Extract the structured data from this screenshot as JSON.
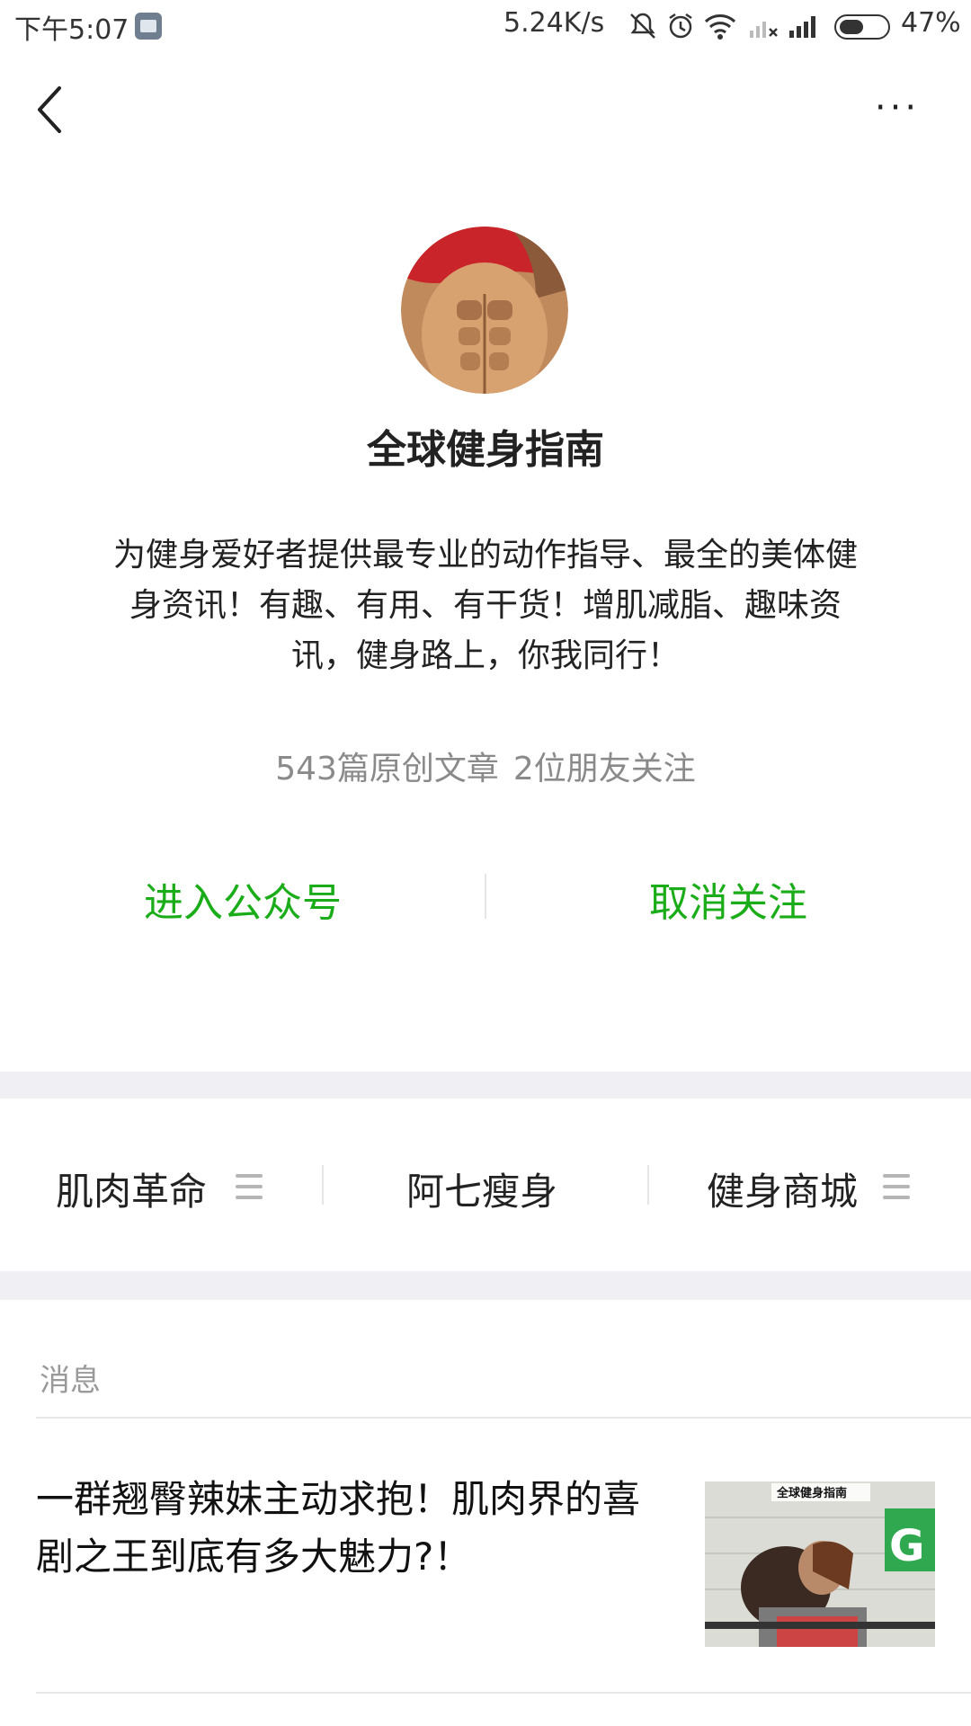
{
  "status_bar": {
    "time": "下午5:07",
    "net_speed": "5.24K/s",
    "battery_pct": "47%",
    "icons": [
      "mute-icon",
      "alarm-icon",
      "wifi-icon",
      "signal-no-sim-icon",
      "signal-icon",
      "battery-icon"
    ]
  },
  "nav": {
    "back_icon": "back-chevron-icon",
    "more_icon": "more-dots-icon",
    "more_label": "···"
  },
  "profile": {
    "name": "全球健身指南",
    "description": "为健身爱好者提供最专业的动作指导、最全的美体健身资讯！有趣、有用、有干货！增肌减脂、趣味资讯，健身路上，你我同行！",
    "stats": {
      "articles": "543篇原创文章",
      "friends": "2位朋友关注"
    },
    "actions": {
      "enter": "进入公众号",
      "unfollow": "取消关注"
    }
  },
  "menu": {
    "items": [
      {
        "label": "肌肉革命",
        "has_submenu": true
      },
      {
        "label": "阿七瘦身",
        "has_submenu": false
      },
      {
        "label": "健身商城",
        "has_submenu": true
      }
    ]
  },
  "messages": {
    "section_label": "消息",
    "items": [
      {
        "title": "一群翘臀辣妹主动求抱！肌肉界的喜剧之王到底有多大魅力?！",
        "thumb_caption": "全球健身指南"
      }
    ]
  },
  "colors": {
    "accent": "#1aad19",
    "muted": "#8a8a8a",
    "divider": "#efeff4"
  }
}
